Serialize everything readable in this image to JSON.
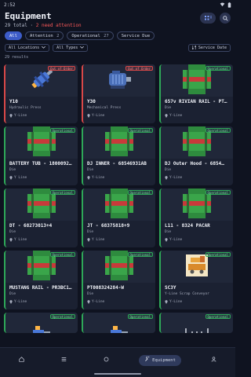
{
  "status": {
    "time": "2:52"
  },
  "header": {
    "title": "Equipment",
    "total": "29 total",
    "separator": "·",
    "attention": "2 need attention"
  },
  "chips": [
    {
      "label": "All",
      "count": "",
      "active": true
    },
    {
      "label": "Attention",
      "count": "2",
      "active": false
    },
    {
      "label": "Operational",
      "count": "27",
      "active": false
    },
    {
      "label": "Service Due",
      "count": "",
      "active": false
    }
  ],
  "filters": {
    "locations": "All Locations",
    "types": "All Types",
    "sort": "Service Date"
  },
  "results": "29 results",
  "cards": [
    {
      "name": "Y10",
      "type": "Hydraulic Press",
      "location": "Y-Line",
      "status": "Out of Order",
      "status_kind": "out",
      "icon": "hydraulic-press-icon"
    },
    {
      "name": "Y30",
      "type": "Mechanical Press",
      "location": "Y-Line",
      "status": "Out of Order",
      "status_kind": "out",
      "icon": "motor-icon"
    },
    {
      "name": "657v RIVIAN RAIL - PT00…",
      "type": "Die",
      "location": "Y-Line",
      "status": "Operational",
      "status_kind": "ok",
      "icon": "die-icon"
    },
    {
      "name": "BATTERY TUB - 1800092S1…",
      "type": "Die",
      "location": "Y Line",
      "status": "Operational",
      "status_kind": "ok",
      "icon": "die-icon"
    },
    {
      "name": "DJ INNER - 68546931AB",
      "type": "Die",
      "location": "Y-Line",
      "status": "Operational",
      "status_kind": "ok",
      "icon": "die-icon"
    },
    {
      "name": "DJ Outer Hood - 6854…",
      "type": "Die",
      "location": "Y-Line",
      "status": "Operational",
      "status_kind": "ok",
      "icon": "die-icon"
    },
    {
      "name": "DT - 68273013+4",
      "type": "Die",
      "location": "Y Line",
      "status": "Operational",
      "status_kind": "ok",
      "icon": "die-icon"
    },
    {
      "name": "JT - 68375818+9",
      "type": "Die",
      "location": "Y Line",
      "status": "Operational",
      "status_kind": "ok",
      "icon": "die-icon"
    },
    {
      "name": "L11 - 8324 PACAR",
      "type": "Die",
      "location": "Y-Line",
      "status": "Operational",
      "status_kind": "ok",
      "icon": "die-icon"
    },
    {
      "name": "MUSTANG RAIL - PR3BC101…",
      "type": "Die",
      "location": "Y-Line",
      "status": "Operational",
      "status_kind": "ok",
      "icon": "die-icon"
    },
    {
      "name": "PT008324284-W",
      "type": "Die",
      "location": "Y-Line",
      "status": "Operational",
      "status_kind": "ok",
      "icon": "die-icon"
    },
    {
      "name": "SC3Y",
      "type": "Y-Line Scrap Conveyor",
      "location": "Y-Line",
      "status": "Operational",
      "status_kind": "ok",
      "icon": "conveyor-icon"
    },
    {
      "name": "",
      "type": "",
      "location": "",
      "status": "Operational",
      "status_kind": "ok",
      "icon": "robot-icon"
    },
    {
      "name": "",
      "type": "",
      "location": "",
      "status": "Operational",
      "status_kind": "ok",
      "icon": "robot-icon"
    },
    {
      "name": "",
      "type": "",
      "location": "",
      "status": "Operational",
      "status_kind": "ok",
      "icon": "bracket-icon"
    }
  ],
  "nav": [
    {
      "label": "",
      "icon": "home-icon",
      "active": false
    },
    {
      "label": "",
      "icon": "list-icon",
      "active": false
    },
    {
      "label": "",
      "icon": "circle-icon",
      "active": false
    },
    {
      "label": "Equipment",
      "icon": "wrench-icon",
      "active": true
    },
    {
      "label": "",
      "icon": "person-icon",
      "active": false
    }
  ]
}
